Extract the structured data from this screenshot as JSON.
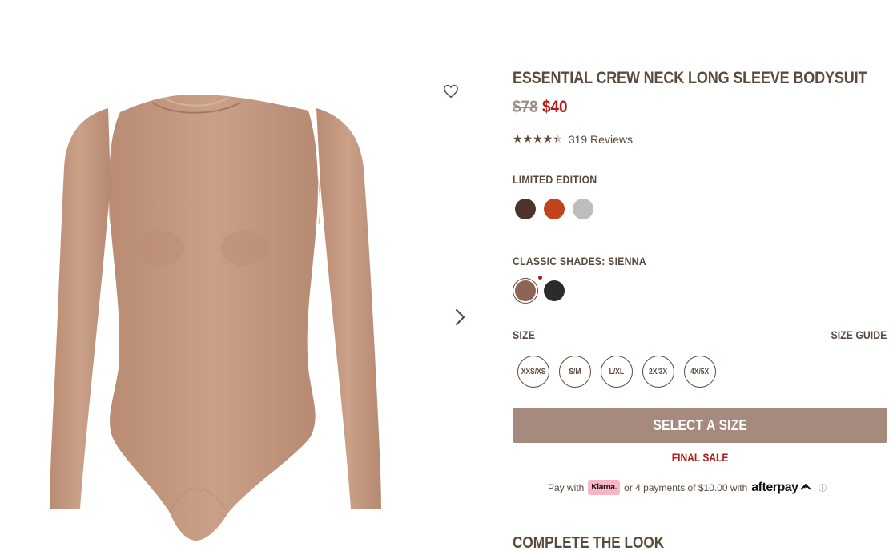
{
  "product": {
    "title": "ESSENTIAL CREW NECK LONG SLEEVE BODYSUIT",
    "price_original": "$78",
    "price_sale": "$40",
    "rating": 4.5,
    "reviews_label": "319 Reviews"
  },
  "gallery": {
    "wishlist_icon": "heart-outline-icon",
    "next_icon": "chevron-right-icon",
    "image_subject": "bodysuit"
  },
  "limited_edition": {
    "label": "LIMITED EDITION",
    "swatches": [
      {
        "color": "#4a342b"
      },
      {
        "color": "#c0451f"
      },
      {
        "color": "#bdbdbd"
      }
    ]
  },
  "classic_shades": {
    "label": "CLASSIC SHADES: SIENNA",
    "swatches": [
      {
        "color": "#8e6457",
        "selected": true
      },
      {
        "color": "#2b2b2b"
      }
    ]
  },
  "size": {
    "label": "SIZE",
    "guide_label": "SIZE GUIDE",
    "options": [
      "XXS/XS",
      "S/M",
      "L/XL",
      "2X/3X",
      "4X/5X"
    ]
  },
  "cta": {
    "label": "SELECT A SIZE",
    "final_sale": "FINAL SALE"
  },
  "payment": {
    "pay_with": "Pay with",
    "klarna_label": "Klarna.",
    "installments": "or 4 payments of $10.00 with",
    "afterpay_label": "afterpay",
    "info_glyph": "i"
  },
  "complete_look": "COMPLETE THE LOOK",
  "colors": {
    "brown_text": "#5a4a3c",
    "sale_red": "#b11a1a",
    "cta_bg": "#a68a7e",
    "klarna_pink": "#f7b6c5"
  }
}
